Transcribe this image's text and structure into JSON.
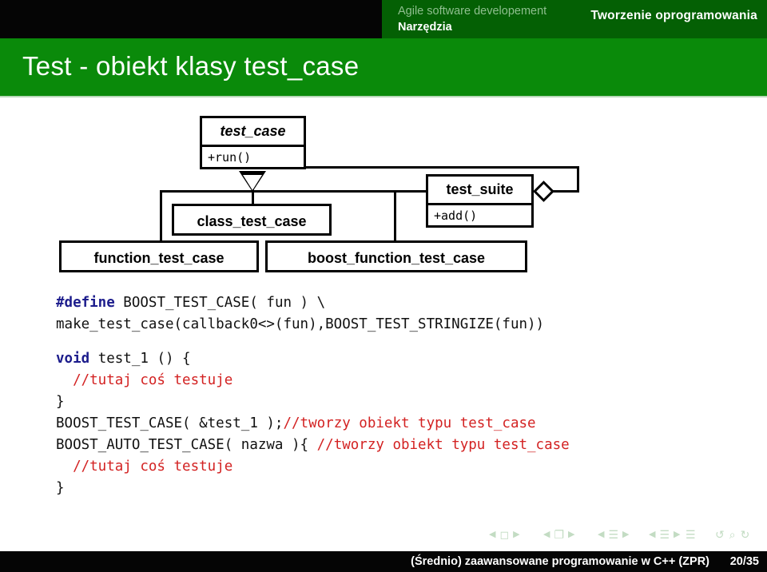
{
  "header": {
    "section_title": "Tworzenie oprogramowania",
    "subtitle_top": "Agile software developement",
    "subtitle_bottom": "Narzędzia"
  },
  "slide": {
    "title": "Test - obiekt klasy test_case"
  },
  "diagram": {
    "type": "uml-class-diagram",
    "classes": [
      {
        "id": "test_case",
        "name": "test_case",
        "abstract": true,
        "operations": [
          "+run()"
        ]
      },
      {
        "id": "test_suite",
        "name": "test_suite",
        "abstract": false,
        "operations": [
          "+add()"
        ]
      },
      {
        "id": "class_test_case",
        "name": "class_test_case",
        "abstract": false,
        "operations": []
      },
      {
        "id": "function_test_case",
        "name": "function_test_case",
        "abstract": false,
        "operations": []
      },
      {
        "id": "boost_function_test_case",
        "name": "boost_function_test_case",
        "abstract": false,
        "operations": []
      }
    ],
    "relations": [
      {
        "kind": "generalization",
        "from": "class_test_case",
        "to": "test_case"
      },
      {
        "kind": "generalization",
        "from": "function_test_case",
        "to": "test_case"
      },
      {
        "kind": "generalization",
        "from": "boost_function_test_case",
        "to": "test_case"
      },
      {
        "kind": "generalization",
        "from": "test_suite",
        "to": "test_case"
      },
      {
        "kind": "aggregation",
        "from": "test_suite",
        "to": "test_case"
      }
    ]
  },
  "code": {
    "lines": [
      {
        "segments": [
          {
            "t": "#define",
            "c": "kw"
          },
          {
            "t": " BOOST_TEST_CASE( fun ) \\",
            "c": "pl"
          }
        ]
      },
      {
        "segments": [
          {
            "t": "make_test_case(callback0<>(fun),BOOST_TEST_STRINGIZE(fun))",
            "c": "pl"
          }
        ]
      },
      {
        "blank": true
      },
      {
        "segments": [
          {
            "t": "void",
            "c": "kw"
          },
          {
            "t": " test_1 () {",
            "c": "pl"
          }
        ]
      },
      {
        "segments": [
          {
            "t": "  ",
            "c": "pl"
          },
          {
            "t": "//tutaj coś testuje",
            "c": "cm"
          }
        ]
      },
      {
        "segments": [
          {
            "t": "}",
            "c": "pl"
          }
        ]
      },
      {
        "segments": [
          {
            "t": "BOOST_TEST_CASE( &test_1 );",
            "c": "pl"
          },
          {
            "t": "//tworzy obiekt typu test_case",
            "c": "cm"
          }
        ]
      },
      {
        "segments": [
          {
            "t": "BOOST_AUTO_TEST_CASE( nazwa ){ ",
            "c": "pl"
          },
          {
            "t": "//tworzy obiekt typu test_case",
            "c": "cm"
          }
        ]
      },
      {
        "segments": [
          {
            "t": "  ",
            "c": "pl"
          },
          {
            "t": "//tutaj coś testuje",
            "c": "cm"
          }
        ]
      },
      {
        "segments": [
          {
            "t": "}",
            "c": "pl"
          }
        ]
      }
    ]
  },
  "navigation": {
    "groups": [
      {
        "left": "◀",
        "symbol": "◻",
        "right": "▶",
        "name": "slide"
      },
      {
        "left": "◀",
        "symbol": "❐",
        "right": "▶",
        "name": "frame"
      },
      {
        "left": "◀",
        "symbol": "☰",
        "right": "▶",
        "name": "subsection"
      },
      {
        "left": "◀",
        "symbol": "☰",
        "right": "▶",
        "name": "section"
      }
    ],
    "doc_symbol": "☰",
    "back_symbol": "↺",
    "search_symbol": "⌕",
    "forward_symbol": "↻"
  },
  "footer": {
    "text": "(Średnio) zaawansowane programowanie w C++ (ZPR)",
    "page": "20/35"
  },
  "colors": {
    "header_dark_green": "#046004",
    "title_green": "#0a8a0a",
    "black_bar": "#050505",
    "keyword_blue": "#1c1c8c",
    "comment_red": "#d32222",
    "nav_pale_green": "#c3dcc3"
  }
}
